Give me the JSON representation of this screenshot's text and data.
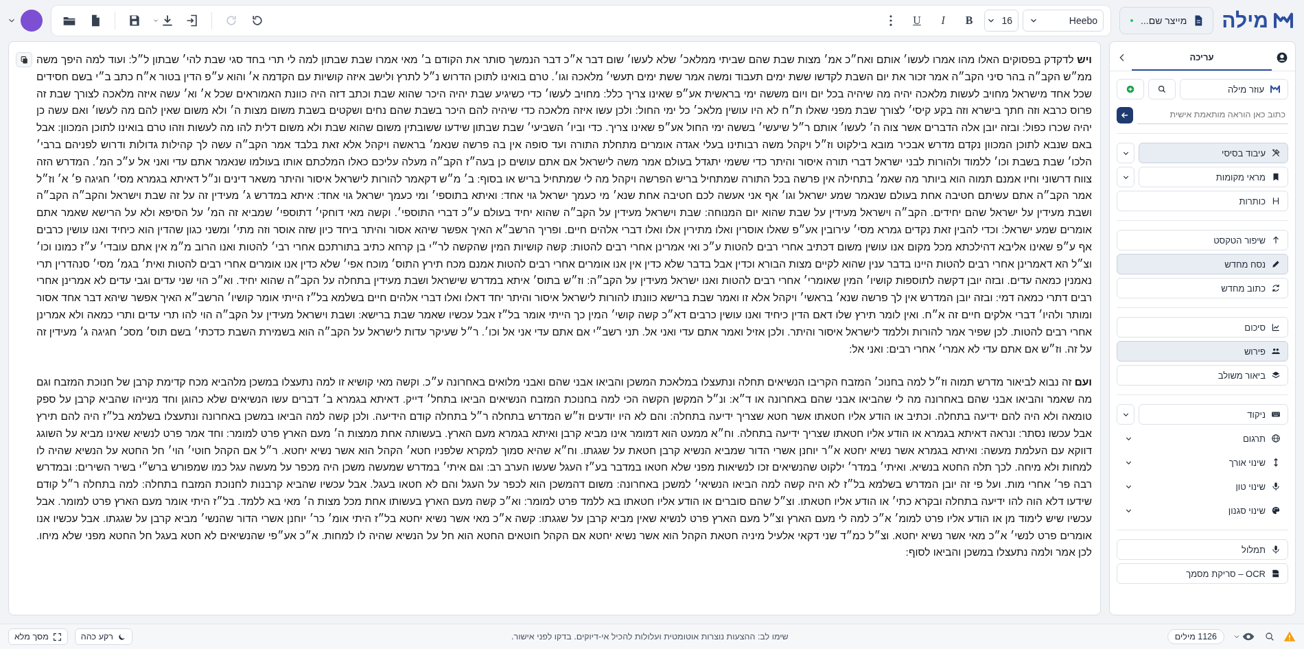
{
  "header": {
    "logo": "מילה",
    "document_button": {
      "label": "מייצר שם..."
    }
  },
  "toolbar": {
    "font": "Heebo",
    "size": "16",
    "format_buttons": [
      {
        "kind": "bold",
        "label": "B"
      },
      {
        "kind": "italic",
        "label": "I"
      },
      {
        "kind": "underline",
        "label": "U"
      }
    ],
    "action_groups": [
      [
        {
          "kind": "undo",
          "disabled": false
        },
        {
          "kind": "redo",
          "disabled": true
        }
      ],
      [
        {
          "kind": "import",
          "disabled": false
        },
        {
          "kind": "download",
          "disabled": false
        },
        {
          "kind": "save",
          "disabled": false
        }
      ],
      [
        {
          "kind": "new_file",
          "disabled": false
        },
        {
          "kind": "open_folder",
          "disabled": false
        }
      ]
    ]
  },
  "document": {
    "paragraphs": [
      "**ויש** לדקדק בפסוקים האלו מהו אמרו לעשו׳ אותם ואח״כ אמ׳ מצות שבת שהם שביתי ממלאכ׳ שלא לעשו׳ שום דבר א״כ דבר הנמשך סותר את הקודם ב׳ מאי אמרו שבת שבתון למה לי תרי בחד סגי שבת להי׳ שבתון ל״ל: ועוד למה היפך משה ממ״ש הקב״ה בהר סיני הקב״ה אמר זכור את יום השבת לקדשו ששת ימים תעבוד ומשה אמר ששת ימים תעשי׳ מלאכה וגו׳. טרם בואינו לתוכן הדרוש נ״ל לתרץ ולישב איזה קושיות עם הקדמה א׳ והוא ע״פ הדין בטור א״ח כתב ב״י בשם חסידים שכל אחד מישראל מחויב לעשות מלאכה יהיה מה שיהיה בכל יום ויום מששה ימי בראשית אע״פ שאינו צריך כלל: מחויב לעשו׳ כדי כשיגיע שבת יהיה היכר שהוא שבת וכתב דזה היה כוונת האמוראים שכל א׳ וא׳ עשה איזה מלאכה לצורך שבת זה פרוס כרבא וזה חתך בישרא וזה בקע קיסי׳ לצורך שבת מפני שאלו ת״ח לא היו עושין מלאכ׳ כל ימי החול: ולכן עשו איזה מלאכה כדי שיהיה להם היכר בשבת שהם נחים ושקטים בשבת משום מצות ה׳ ולא משום שאין להם מה לעשו׳ ואם עשה כן יהיה שכרו כפול: ובזה יובן אלה הדברים אשר צוה ה׳ לעשו׳ אותם ר״ל שיעשי׳ בששה ימי החול אע״פ שאינו צריך. כדי וביו׳ השביעי׳ שבת שבתון שידעו ששובתין משום שהוא שבת ולא משום דלית להו מה לעשות וזהו טרם בואינו לתוכן המכוון: אבל באם שנבא לתוכן המכוון נקדם מדרש אבכיר מובא בילקוט וז״ל ויקהל משה רבותינו בעלי אגדה אומרים מתחלת התורה ועד סופה אין בה פרשה שנאמ׳ בראשה ויקהל אלא זאת בלבד אמר הקב״ה עשה לך קהילות גדולות ודרוש לפניהם ברבי׳ הלכו׳ שבת בשבת וכו׳ ללמוד ולהורות לבני ישראל דברי תורה איסור והיתר כדי ששמי יתגדל בעולם אמר משה לישראל אם אתם עושים כן בעה״ז הקב״ה מעלה עליכם כאלו המלכתם אותו בעולמו שנאמר אתם עדי ואני אל ע״כ המ׳. המדרש הזה צווח דרשוני וחיו אמנם תמוה הוא ביותר מה שאמ׳ בתחילה אין פרשה בכל התורה שמתחיל בריש הפרשה ויקהל מה לי שמתחיל בריש או בסוף: ב׳ מ״ש דקאמר להורות לישראל איסור והיתר משאר דינים ונ״ל דאיתא בגמרא מסי׳ חגיגה פ׳ א׳ וז״ל אמר הקב״ה אתם עשיתם חטיבה אחת בעולם שנאמר שמע ישראל וגו׳ אף אני אעשה לכם חטיבה אחת שנא׳ מי כעמך ישראל גוי אחד: ואיתא בתוספי׳ ומי כעמך ישראל גוי אחד: איתא במדרש ג׳ מעידין זה על זה שבת וישראל והקב״ה הקב״ה ושבת מעידין על ישראל שהם יחידים. הקב״ה וישראל מעידין על שבת שהוא יום המנוחה: שבת וישראל מעידין על הקב״ה שהוא יחיד בעולם ע״כ דברי התוספי׳. וקשה מאי דוחקי׳ דתוספי׳ שמביא זה המ׳ על הסיפא ולא על הרישא שאמר אתם אומרים שמע ישראל: וכדי להבין זאת נקדים גמרא מסי׳ עירובין אע״פ שאלו אוסרין ואלו מתירין אלו ואלו דברי אלהים חיים. ופריך הרשב״א האיך אפשר שיהא אסור והיתר ביחד כיון שזה אוסר וזה מתי׳ ומשני כגון שהדין הוא כיחיד ואנו עושין כרבים אף ע״פ שאינו אליבא דהילכתא מכל מקום אנו עושין משום דכתיב אחרי רבים להטות ע״כ ואי אמרינן אחרי רבים להטות: קשה קושיות המין שהקשה לר״י בן קרחא כתיב בתורתכם אחרי רבי׳ להטות ואנו הרוב מ״מ אין אתם עובדי׳ ע״ז כמונו וכו׳ וצ״ל הא דאמרינן אחרי רבים להטות היינו בדבר ענין שהוא לקיים מצות הבורא וכדין אבל בדבר שלא כדין אין אנו אומרים אחרי רבים להטות אמנם מכח תירץ התוס׳ מוכח אפי׳ שלא כדין אנו אומרים אחרי רבים להטות ואית׳ בגמ׳ מסי׳ סנהדרין תרי נאמנין כמאה עדים. ובזה יובן דקשה לתוספות קושיו׳ המין שאומרי׳ אחרי רבים להטות ואנו ישראל מעידין על הקב״ה: וז״ש בתוס׳ איתא במדרש שישראל ושבת מעידין בתחלה על הקב״ה שהוא יחיד. וא״כ הוי שני עדים וגבי עדים לא אמרינן אחרי רבים דתרי כמאה דמי: ובזה יובן המדרש אין לך פרשה שנא׳ בראשי׳ ויקהל אלא זו ואמר שבת ברישא כוונתו להורות לישראל איסור והיתר יחד דאלו ואלו דברי אלהים חיים בשלמא בל״ז הייתי אומר קושיו׳ הרשב״א האיך אפשר שיהא דבר אחד אסור ומותר ולהיו׳ דברי אלקים חיים זה א״ח. ואין לומר תירץ שלו דאם הדין כיחיד ואנו עושין כרבים דא״כ קשה קושי׳ המין כך הייתי אומר בל״ז אבל עכשיו שאמר שבת ברישא: ושבת וישראל מעידין על הקב״ה הוי להו תרי עדים ותרי כמאה ולא אמרינן אחרי רבים להטות. לכן שפיר אמר להורות וללמד לישראל איסור והיתר. ולכן אזיל ואמר אתם עדי ואני אל. תני רשב״י אם אתם עדי אני אל וכו׳. ר״ל שעיקר עדות לישראל על הקב״ה הוא בשמירת השבת כדכתי׳ בשם תוס׳ מסכ׳ חגיגה ג׳ מעידין זה על זה. וז״ש אם אתם עדי לא אמרי׳ אחרי רבים: ואני אל:",
      "**ועם** זה נבוא לביאור מדרש תמוה וז״ל למה בחנוכ׳ המזבח הקריבו הנשיאים תחלה ונתעצלו במלאכת המשכן והביאו אבני שהם ואבני מלואים באחרונה ע״כ. וקשה מאי קושיא זו למה נתעצלו במשכן מלהביא מכח קדימת קרבן של חנוכת המזבח וגם מה שאמר והביאו אבני שהם באחרונה מה לי שהביאו אבני שהם באחרונה או ד״א: ונ״ל המקשן הקשה הכי למה בחנוכת המזבח הנשיאים הביאו בתחל׳ דייק. דאיתא בגמרא ב׳ דברים עשו הנשיאים שלא כהוגן וחד מנייהו שהביא קרבן על ספק טומאה ולא היה להם ידיעה בתחלה. וכתיב או הודע אליו חטאתו אשר חטא שצריך ידיעה בתחלה: והם לא היו יודעים וז״ש המדרש בתחלה ר״ל בתחלה קודם הידיעה. ולכן קשה למה הביאו במשכן באחרונה ונתעצלו בשלמא בל״ז היה להם תירץ אבל עכשו נסתר: ונראה דאיתא בגמרא או הודע אליו חטאתו שצריך ידיעה בתחלה. וח״א ממעט הוא דמומר אינו מביא קרבן ואיתא בגמרא מעם הארץ. בעשותה אחת ממצות ה׳ מעם הארץ פרט למומר: וחד אמר פרט לנשיא שאינו מביא על השוגג דווקא עם העלמת מעשה: ואיתא בגמרא אשר נשיא יחטא א״ר יוחנן אשרי הדור שמביא הנשיא קרבן חטאת על שגגתו. וח״א שהיא סמוך למקרא שלפניו חטא׳ הקהל הוא אשר נשיא יחטא. ר״ל אם הקהל חוטי׳ הוי׳ חל החטא על הנשיא שהיה לו למחות ולא מיחה. לכך תלה החטא בנשיא. ואיתי׳ במדר׳ ילקוט שהנשיאים זכו לנשיאות מפני שלא חטאו במדבר בע״ז העגל שעשו הערב רב: וגם איתי׳ במדרש שמעשה משכן היה מכפר על מעשה עגל כמו שמפורש ברש״י בשיר השירים: ובמדרש רבה פר׳ אחרי מות. ועל פי זה יובן המדרש בשלמא בל״ז לא היה קשה למה הביאו הנשיאי׳ למשכן באחרונה: משום דהמשכן הוא לכפר על העגל והם לא חטאו בעגל. אבל עכשיו שהביא קרבנות לחנוכת המזבח בתחלה: למה בתחלה ר״ל קודם שידעו דלא הוה להו ידיעה בתחלה ובקרא כתי׳ או הודע אליו חטאתו. וצ״ל שהם סוברים או הודע אליו חטאתו בא ללמד פרט למומר: וא״כ קשה מעם הארץ בעשותו אחת מכל מצות ה׳ מאי בא ללמד. בל״ז היתי אומר מעם הארץ פרט למומר. אבל עכשיו שיש לימוד מן או הודע אליו פרט למומ׳ א״כ למה לי מעם הארץ וצ״ל מעם הארץ פרט לנשיא שאין מביא קרבן על שגגתו: קשה א״כ מאי אשר נשיא יחטא בל״ז היתי אומ׳ כר׳ יוחנן אשרי הדור שהנשי׳ מביא קרבן על שגגתו. אבל עכשיו אנו אומרים פרט לנשי׳ א״כ מאי אשר נשיא יחטא. וצ״ל כמ״ד שני דקאי אלעיל מיניה חטאת הקהל הוא אשר נשיא יחטא אם הקהל חוטאים החטא הוא חל על הנשיא שהיה לו למחות. א״כ אע״פי שהנשיאים לא חטא בעגל חל החטא מפני שלא מיחו. לכן אמר ולמה נתעצלו במשכן והביאו לסוף:"
    ]
  },
  "sidebar": {
    "tabs": [
      {
        "label": "עריכה",
        "selected": true
      }
    ],
    "assistant_button": "עוזר מילה",
    "prompt": {
      "placeholder": "כתוב כאן הוראה מותאמת אישית"
    },
    "sections": [
      [
        {
          "label": "עיבוד בסיסי",
          "kind": "split",
          "selected": true
        },
        {
          "label": "מראי מקומות",
          "kind": "split",
          "selected": false
        },
        {
          "label": "כותרות",
          "kind": "action",
          "selected": false
        }
      ],
      [
        {
          "label": "שיפור הטקסט",
          "kind": "action",
          "selected": false
        },
        {
          "label": "נסח מחדש",
          "kind": "action",
          "selected": true
        },
        {
          "label": "כתוב מחדש",
          "kind": "action",
          "selected": false
        }
      ],
      [
        {
          "label": "סיכום",
          "kind": "action",
          "selected": false
        },
        {
          "label": "פירוש",
          "kind": "action",
          "selected": true
        },
        {
          "label": "ביאור משולב",
          "kind": "action",
          "selected": false
        }
      ],
      [
        {
          "label": "ניקוד",
          "kind": "split",
          "selected": false
        },
        {
          "label": "תרגום",
          "kind": "submenu",
          "selected": false
        },
        {
          "label": "שינוי אורך",
          "kind": "submenu",
          "selected": false
        },
        {
          "label": "שינוי טון",
          "kind": "submenu",
          "selected": false
        },
        {
          "label": "שינוי סגנון",
          "kind": "submenu",
          "selected": false
        }
      ],
      [
        {
          "label": "תמלול",
          "kind": "action",
          "selected": false
        },
        {
          "label": "OCR – סריקת מסמך",
          "kind": "action",
          "selected": false
        }
      ]
    ]
  },
  "status_bar": {
    "word_count": "1126 מילים",
    "notice": "שימו לב: ההצעות נוצרות אוטומטית ועלולות להכיל אי-דיוקים. בדקו לפני אישור.",
    "buttons": [
      {
        "kind": "dark_mode",
        "label": "רקע כהה"
      },
      {
        "kind": "fullscreen",
        "label": "מסך מלא"
      }
    ]
  }
}
